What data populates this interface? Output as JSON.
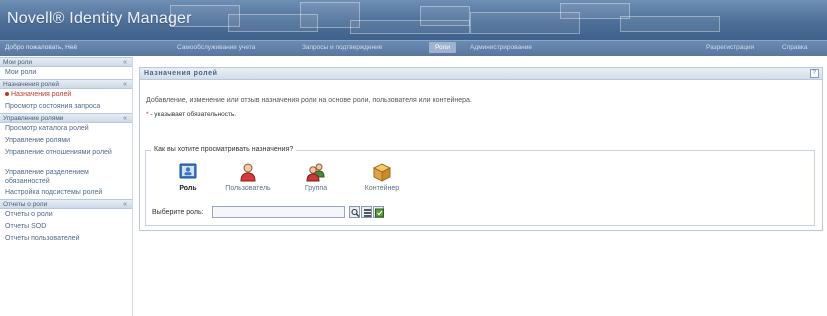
{
  "header": {
    "app_title": "Novell® Identity Manager"
  },
  "navbar": {
    "welcome": "Добро пожаловать, Неё",
    "tabs": [
      {
        "label": "Самообслуживание учета"
      },
      {
        "label": "Запросы и подтверждение"
      },
      {
        "label": "Роли"
      },
      {
        "label": "Администрирование"
      }
    ],
    "right_links": [
      {
        "label": "Разрегистрация"
      },
      {
        "label": "Справка"
      }
    ]
  },
  "sidebar": {
    "sections": [
      {
        "title": "Мои роли",
        "items": [
          "Мои роли"
        ]
      },
      {
        "title": "Назначения ролей",
        "items": [
          "Назначения ролей",
          "Просмотр состояния запроса"
        ]
      },
      {
        "title": "Управление ролями",
        "items": [
          "Просмотр каталога ролей",
          "Управление ролями",
          "Управление отношениями ролей",
          "Управление разделением обязанностей",
          "Настройка подсистемы ролей"
        ]
      },
      {
        "title": "Отчеты о роли",
        "items": [
          "Отчеты о роли",
          "Отчеты SOD",
          "Отчеты пользователей"
        ]
      }
    ],
    "collapse_glyph": "«",
    "active_item": "Назначения ролей"
  },
  "main": {
    "panel_title": "Назначения ролей",
    "help_glyph": "?",
    "description": "Добавление, изменение или отзыв назначения роли на основе роли, пользователя или контейнера.",
    "required_star": "*",
    "required_text": " - указывает обязательность.",
    "view_legend": "Как вы хотите просматривать назначения?",
    "options": [
      {
        "label": "Роль",
        "icon": "role-icon",
        "selected": true
      },
      {
        "label": "Пользователь",
        "icon": "user-icon",
        "selected": false
      },
      {
        "label": "Группа",
        "icon": "group-icon",
        "selected": false
      },
      {
        "label": "Контейнер",
        "icon": "container-icon",
        "selected": false
      }
    ],
    "pick_label": "Выберите роль:",
    "pick_value": "",
    "pick_buttons": [
      "search-icon",
      "history-icon",
      "reset-icon"
    ]
  },
  "colors": {
    "header_blue": "#4d6f98",
    "active_red": "#c0392b",
    "link_blue": "#516a8a"
  }
}
